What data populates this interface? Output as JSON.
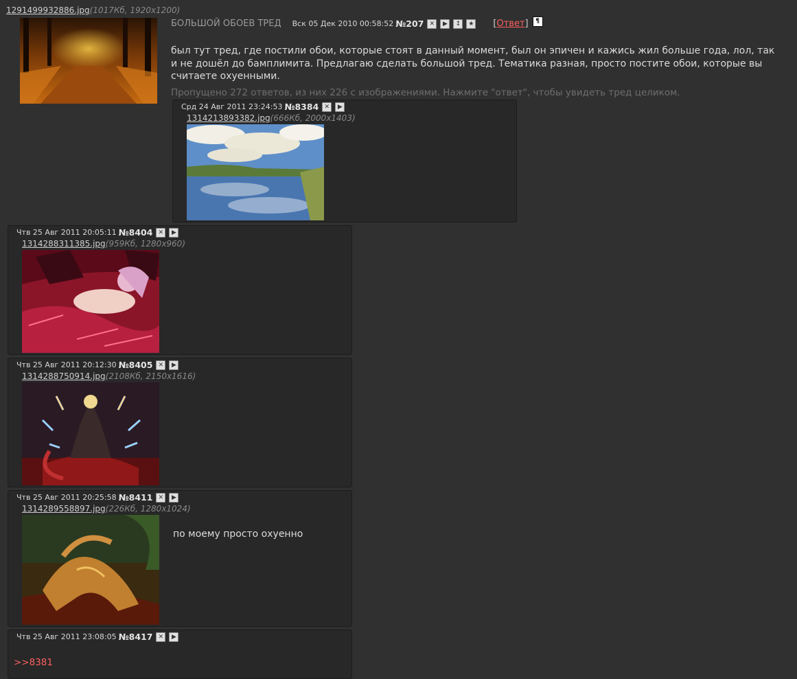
{
  "op": {
    "file_name": "1291499932886.jpg",
    "file_meta": "(1017Кб, 1920x1200)",
    "subject": "БОЛЬШОЙ ОБОЕВ ТРЕД",
    "date": "Вск 05 Дек 2010 00:58:52",
    "number": "№207",
    "reply_label": "Ответ",
    "text": "был тут тред, где постили обои, которые стоят в данный момент, был он эпичен и кажись жил больше года, лол, так и не дошёл до бамплимита. Предлагаю сделать большой тред. Тематика разная, просто постите обои, которые вы считаете охуенными.",
    "omitted": "Пропущено 272 ответов, из них 226 с изображениями. Нажмите \"ответ\", чтобы увидеть тред целиком."
  },
  "posts": [
    {
      "date": "Срд 24 Авг 2011 23:24:53",
      "number": "№8384",
      "file_name": "1314213893382.jpg",
      "file_meta": "(666Кб, 2000x1403)"
    },
    {
      "date": "Чтв 25 Авг 2011 20:05:11",
      "number": "№8404",
      "file_name": "1314288311385.jpg",
      "file_meta": "(959Кб, 1280x960)"
    },
    {
      "date": "Чтв 25 Авг 2011 20:12:30",
      "number": "№8405",
      "file_name": "1314288750914.jpg",
      "file_meta": "(2108Кб, 2150x1616)"
    },
    {
      "date": "Чтв 25 Авг 2011 20:25:58",
      "number": "№8411",
      "file_name": "1314289558897.jpg",
      "file_meta": "(226Кб, 1280x1024)",
      "text": "по моему просто охуенно"
    },
    {
      "date": "Чтв 25 Авг 2011 23:08:05",
      "number": "№8417",
      "quote": ">>8381"
    }
  ],
  "icons": {
    "delete": "delete-icon",
    "play": "play-icon",
    "updown": "updown-icon",
    "star": "star-icon",
    "bookmark": "bookmark-icon"
  },
  "colors": {
    "background": "#303030",
    "post_background": "#282828",
    "link_red": "#ff5f5f",
    "muted": "#6e6e6e"
  }
}
